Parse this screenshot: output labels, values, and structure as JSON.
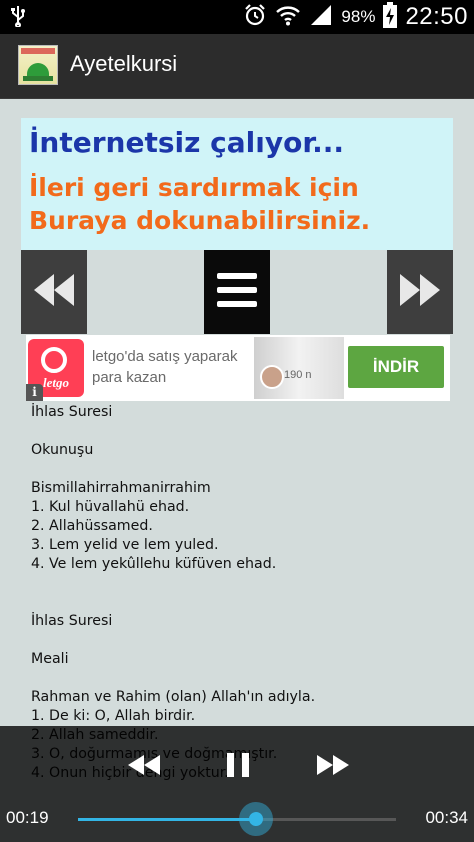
{
  "status_bar": {
    "battery_percent": "98%",
    "time": "22:50",
    "icons": [
      "usb-icon",
      "alarm-icon",
      "wifi-icon",
      "signal-icon",
      "battery-charging-icon"
    ]
  },
  "app": {
    "title": "Ayetelkursi",
    "icon": "app-logo-icon"
  },
  "banner": {
    "line1": "İnternetsiz çalıyor...",
    "line2": "İleri geri sardırmak için",
    "line3": "Buraya dokunabilirsiniz.",
    "colors": {
      "line1": "#1b36a9",
      "line2": "#f26a1b",
      "background": "#d0f4f8"
    }
  },
  "controls": {
    "rewind": "rewind-icon",
    "menu": "menu-icon",
    "fast_forward": "fast-forward-icon"
  },
  "ad": {
    "brand": "letgo",
    "text_line1": "letgo'da satış yaparak",
    "text_line2": "para kazan",
    "photo_caption": "190 n",
    "cta": "İNDİR",
    "info": "i",
    "cta_color": "#5da641",
    "logo_color": "#ff3f55"
  },
  "content": {
    "lines": [
      "İhlas Suresi",
      "",
      "Okunuşu",
      "",
      "Bismillahirrahmanirrahim",
      "1. Kul hüvallahü ehad.",
      "2. Allahüssamed.",
      "3. Lem yelid ve lem yuled.",
      "4. Ve lem yekûllehu küfüven ehad.",
      "",
      "",
      "İhlas Suresi",
      "",
      "Meali",
      "",
      "Rahman ve Rahim (olan) Allah'ın adıyla.",
      "1. De ki: O, Allah birdir.",
      "2. Allah sameddir.",
      "3. O, doğurmamış ve doğmamıştır.",
      "4. Onun hiçbir dengi yoktur."
    ]
  },
  "player": {
    "elapsed": "00:19",
    "total": "00:34",
    "progress": 0.56,
    "accent": "#33b5e5"
  }
}
